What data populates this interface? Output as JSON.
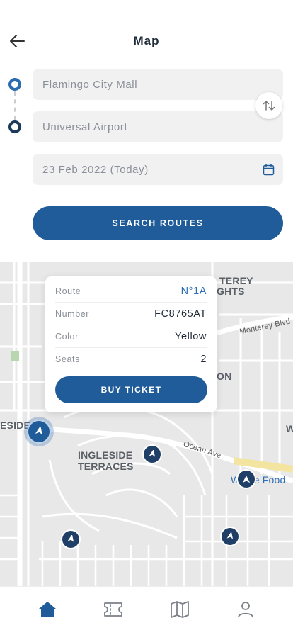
{
  "header": {
    "title": "Map"
  },
  "route": {
    "from_value": "Flamingo City Mall",
    "to_value": "Universal Airport",
    "date_value": "23 Feb 2022 (Today)",
    "search_label": "SEARCH ROUTES"
  },
  "map": {
    "labels": {
      "monterey_1": "TEREY",
      "monterey_2": "GHTS",
      "monterey_blvd": "Monterey Blvd",
      "on": "ON",
      "ingleside_1": "INGLESIDE",
      "ingleside_2": "TERRACES",
      "ingleside_left": "ESIDE",
      "ocean_ave": "Ocean Ave",
      "whole_food": "Whole Food",
      "w_edge": "W"
    }
  },
  "card": {
    "rows": [
      {
        "key": "Route",
        "value": "N°1A"
      },
      {
        "key": "Number",
        "value": "FC8765AT"
      },
      {
        "key": "Color",
        "value": "Yellow"
      },
      {
        "key": "Seats",
        "value": "2"
      }
    ],
    "buy_label": "BUY TICKET"
  },
  "nav": {
    "items": [
      {
        "icon": "home-icon",
        "active": true
      },
      {
        "icon": "ticket-icon",
        "active": false
      },
      {
        "icon": "map-icon",
        "active": false
      },
      {
        "icon": "user-icon",
        "active": false
      }
    ]
  },
  "colors": {
    "primary": "#1f5c99",
    "accent": "#2d6db5",
    "marker": "#1f3f66",
    "inactive_icon": "#7b8089"
  }
}
